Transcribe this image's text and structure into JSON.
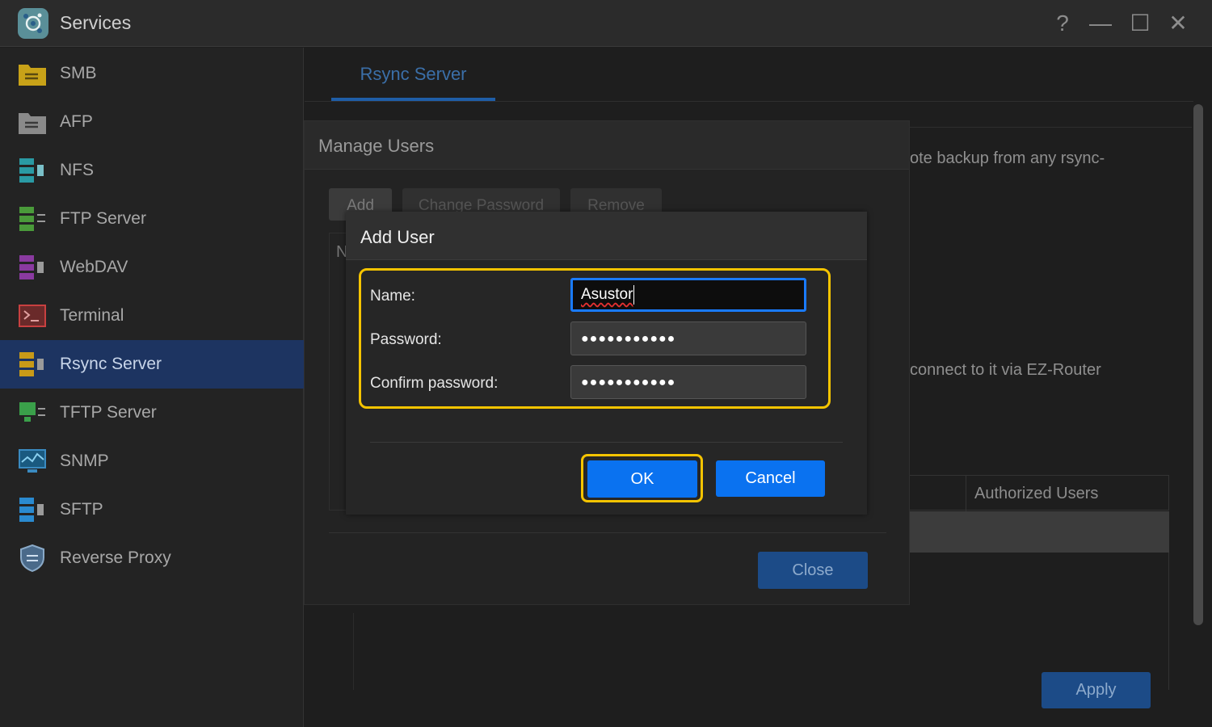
{
  "window": {
    "title": "Services",
    "controls": {
      "help": "?",
      "minimize": "—",
      "maximize": "☐",
      "close": "✕"
    }
  },
  "sidebar": {
    "items": [
      {
        "label": "SMB",
        "icon": "smb-folder-icon",
        "color": "#c8a218"
      },
      {
        "label": "AFP",
        "icon": "afp-folder-icon",
        "color": "#8a8a8a"
      },
      {
        "label": "NFS",
        "icon": "nfs-server-icon",
        "color": "#2a9aa4"
      },
      {
        "label": "FTP Server",
        "icon": "ftp-server-icon",
        "color": "#4a9a3a"
      },
      {
        "label": "WebDAV",
        "icon": "webdav-server-icon",
        "color": "#8a3aa0"
      },
      {
        "label": "Terminal",
        "icon": "terminal-icon",
        "color": "#c84040"
      },
      {
        "label": "Rsync Server",
        "icon": "rsync-server-icon",
        "color": "#c89a18"
      },
      {
        "label": "TFTP Server",
        "icon": "tftp-server-icon",
        "color": "#3aa04a"
      },
      {
        "label": "SNMP",
        "icon": "snmp-monitor-icon",
        "color": "#3a8ac0"
      },
      {
        "label": "SFTP",
        "icon": "sftp-server-icon",
        "color": "#2a8ad0"
      },
      {
        "label": "Reverse Proxy",
        "icon": "reverse-proxy-shield-icon",
        "color": "#6a8ab0"
      }
    ],
    "active_index": 6
  },
  "main": {
    "tab_label": "Rsync Server",
    "bg_text_1": "ote backup from any rsync-",
    "bg_text_2": "connect to it via EZ-Router",
    "table_header": "Authorized Users",
    "apply_label": "Apply"
  },
  "manage_users": {
    "title": "Manage Users",
    "add_label": "Add",
    "change_password_label": "Change Password",
    "remove_label": "Remove",
    "table_letter": "N",
    "close_label": "Close"
  },
  "add_user": {
    "title": "Add User",
    "name_label": "Name:",
    "name_value": "Asustor",
    "password_label": "Password:",
    "password_value": "●●●●●●●●●●●",
    "confirm_label": "Confirm password:",
    "confirm_value": "●●●●●●●●●●●",
    "ok_label": "OK",
    "cancel_label": "Cancel"
  },
  "colors": {
    "accent_blue": "#0a72f0",
    "highlight_yellow": "#f5c400",
    "active_sidebar": "#1d3461"
  }
}
